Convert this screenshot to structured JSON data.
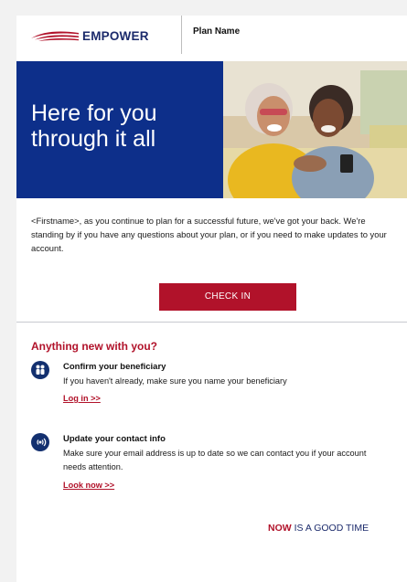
{
  "header": {
    "brand": "EMPOWER",
    "plan_name": "Plan Name"
  },
  "hero": {
    "title_line1": "Here for you",
    "title_line2": "through it all"
  },
  "intro": {
    "text": "<Firstname>, as you continue to plan for a successful future, we've got your back. We're standing by if you have any questions about your plan, or if you need to make updates to your account."
  },
  "cta": {
    "label": "CHECK IN"
  },
  "section": {
    "title": "Anything new with you?",
    "items": [
      {
        "icon": "people-icon",
        "title": "Confirm your beneficiary",
        "desc": "If you haven't already, make sure you name your beneficiary",
        "link": "Log in >>"
      },
      {
        "icon": "broadcast-icon",
        "title": "Update your contact info",
        "desc": "Make sure your email address is up to date so we can contact you if your account needs attention.",
        "link": "Look now >>"
      }
    ]
  },
  "tagline": {
    "now": "NOW",
    "rest": "IS A GOOD TIME"
  },
  "colors": {
    "brand_navy": "#0d2f8a",
    "accent_red": "#b1122a",
    "icon_navy": "#13306f"
  }
}
